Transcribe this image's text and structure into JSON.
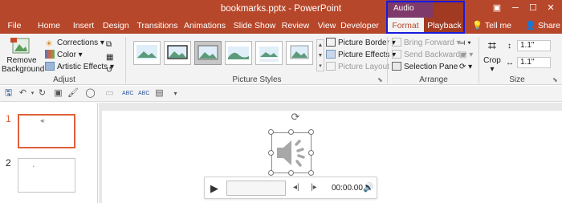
{
  "titlebar": {
    "document_title": "bookmarks.pptx - PowerPoint",
    "context_group": "Audio Tools"
  },
  "tabs": [
    "File",
    "Home",
    "Insert",
    "Design",
    "Transitions",
    "Animations",
    "Slide Show",
    "Review",
    "View",
    "Developer",
    "Format",
    "Playback"
  ],
  "tellme": "Tell me",
  "share": "Share",
  "ribbon": {
    "adjust": {
      "remove_background_1": "Remove",
      "remove_background_2": "Background",
      "corrections": "Corrections",
      "color": "Color",
      "artistic_effects": "Artistic Effects",
      "label": "Adjust"
    },
    "picture_styles": {
      "picture_border": "Picture Border",
      "picture_effects": "Picture Effects",
      "picture_layout": "Picture Layout",
      "label": "Picture Styles"
    },
    "arrange": {
      "bring_forward": "Bring Forward",
      "send_backward": "Send Backward",
      "selection_pane": "Selection Pane",
      "label": "Arrange"
    },
    "size": {
      "crop": "Crop",
      "height": "1.1\"",
      "width": "1.1\"",
      "label": "Size"
    }
  },
  "slides": [
    {
      "number": "1"
    },
    {
      "number": "2"
    }
  ],
  "player": {
    "time": "00:00.00"
  },
  "colors": {
    "accent": "#b7472a",
    "context_tab": "#7e3a6a",
    "highlight": "#1a1adb"
  }
}
